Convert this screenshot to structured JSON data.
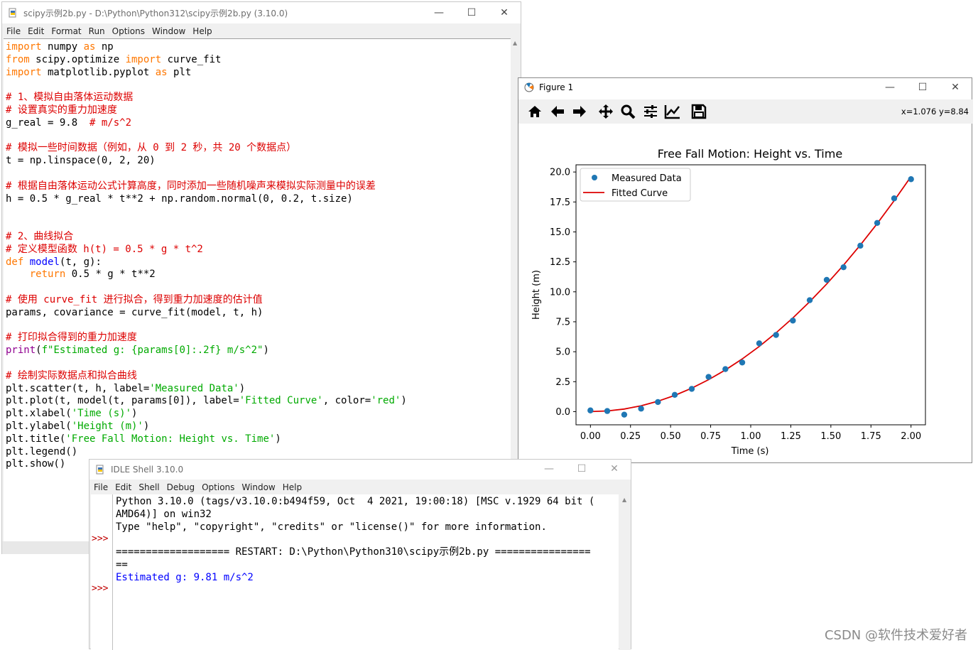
{
  "editor": {
    "title": "scipy示例2b.py - D:\\Python\\Python312\\scipy示例2b.py (3.10.0)",
    "menu": [
      "File",
      "Edit",
      "Format",
      "Run",
      "Options",
      "Window",
      "Help"
    ],
    "code_lines": [
      "import numpy as np",
      "from scipy.optimize import curve_fit",
      "import matplotlib.pyplot as plt",
      "",
      "# 1、模拟自由落体运动数据",
      "# 设置真实的重力加速度",
      "g_real = 9.8  # m/s^2",
      "",
      "# 模拟一些时间数据（例如，从 0 到 2 秒，共 20 个数据点）",
      "t = np.linspace(0, 2, 20)",
      "",
      "# 根据自由落体运动公式计算高度，同时添加一些随机噪声来模拟实际测量中的误差",
      "h = 0.5 * g_real * t**2 + np.random.normal(0, 0.2, t.size)",
      "",
      "",
      "# 2、曲线拟合",
      "# 定义模型函数 h(t) = 0.5 * g * t^2",
      "def model(t, g):",
      "    return 0.5 * g * t**2",
      "",
      "# 使用 curve_fit 进行拟合，得到重力加速度的估计值",
      "params, covariance = curve_fit(model, t, h)",
      "",
      "# 打印拟合得到的重力加速度",
      "print(f\"Estimated g: {params[0]:.2f} m/s^2\")",
      "",
      "# 绘制实际数据点和拟合曲线",
      "plt.scatter(t, h, label='Measured Data')",
      "plt.plot(t, model(t, params[0]), label='Fitted Curve', color='red')",
      "plt.xlabel('Time (s)')",
      "plt.ylabel('Height (m)')",
      "plt.title('Free Fall Motion: Height vs. Time')",
      "plt.legend()",
      "plt.show()"
    ]
  },
  "figure": {
    "title": "Figure 1",
    "toolbar_icons": [
      "home-icon",
      "back-icon",
      "forward-icon",
      "pan-icon",
      "zoom-icon",
      "subplots-icon",
      "axes-edit-icon",
      "save-icon"
    ],
    "coords": "x=1.076 y=8.84"
  },
  "chart_data": {
    "type": "scatter",
    "title": "Free Fall Motion: Height vs. Time",
    "xlabel": "Time (s)",
    "ylabel": "Height (m)",
    "xlim": [
      -0.09,
      2.09
    ],
    "ylim": [
      -1.1,
      20.6
    ],
    "xticks": [
      "0.00",
      "0.25",
      "0.50",
      "0.75",
      "1.00",
      "1.25",
      "1.50",
      "1.75",
      "2.00"
    ],
    "yticks": [
      "0.0",
      "2.5",
      "5.0",
      "7.5",
      "10.0",
      "12.5",
      "15.0",
      "17.5",
      "20.0"
    ],
    "legend_position": "upper-left",
    "legend": [
      "Measured Data",
      "Fitted Curve"
    ],
    "series": [
      {
        "name": "Measured Data",
        "kind": "scatter",
        "color": "#1f77b4",
        "x": [
          0.0,
          0.105,
          0.211,
          0.316,
          0.421,
          0.526,
          0.632,
          0.737,
          0.842,
          0.947,
          1.053,
          1.158,
          1.263,
          1.368,
          1.474,
          1.579,
          1.684,
          1.789,
          1.895,
          2.0
        ],
        "y": [
          0.1,
          0.05,
          -0.25,
          0.25,
          0.8,
          1.4,
          1.9,
          2.9,
          3.55,
          4.1,
          5.7,
          6.4,
          7.6,
          9.3,
          11.0,
          12.05,
          13.85,
          15.75,
          17.8,
          19.4
        ]
      },
      {
        "name": "Fitted Curve",
        "kind": "line",
        "color": "#dd0000",
        "g": 9.81
      }
    ]
  },
  "shell": {
    "title": "IDLE Shell 3.10.0",
    "menu": [
      "File",
      "Edit",
      "Shell",
      "Debug",
      "Options",
      "Window",
      "Help"
    ],
    "lines": [
      "Python 3.10.0 (tags/v3.10.0:b494f59, Oct  4 2021, 19:00:18) [MSC v.1929 64 bit (",
      "AMD64)] on win32",
      "Type \"help\", \"copyright\", \"credits\" or \"license()\" for more information.",
      "",
      "=================== RESTART: D:\\Python\\Python310\\scipy示例2b.py ================",
      "==",
      "Estimated g: 9.81 m/s^2"
    ],
    "prompts": [
      ">>>",
      ">>>"
    ]
  },
  "watermark": "CSDN @软件技术爱好者"
}
